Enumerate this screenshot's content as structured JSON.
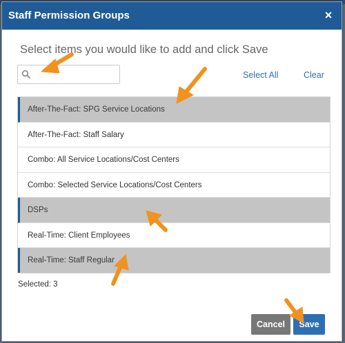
{
  "dialog": {
    "title": "Staff Permission Groups",
    "close_label": "×",
    "subtitle": "Select items you would like to add and click Save"
  },
  "search": {
    "placeholder": "",
    "value": "",
    "icon": "search-icon"
  },
  "links": {
    "select_all": "Select All",
    "clear": "Clear"
  },
  "list": {
    "items": [
      {
        "label": "After-The-Fact: SPG Service Locations",
        "selected": true
      },
      {
        "label": "After-The-Fact: Staff Salary",
        "selected": false
      },
      {
        "label": "Combo: All Service Locations/Cost Centers",
        "selected": false
      },
      {
        "label": "Combo: Selected Service Locations/Cost Centers",
        "selected": false
      },
      {
        "label": "DSPs",
        "selected": true
      },
      {
        "label": "Real-Time: Client Employees",
        "selected": false
      },
      {
        "label": "Real-Time: Staff Regular",
        "selected": true
      }
    ]
  },
  "status": {
    "selected_text": "Selected: 3"
  },
  "buttons": {
    "cancel": "Cancel",
    "save": "Save"
  },
  "colors": {
    "header_bg": "#1f5b96",
    "selected_row_bg": "#c4c4c4",
    "link": "#2d6fb3",
    "save_bg": "#2d6fb3",
    "cancel_bg": "#777777",
    "annotation_arrow": "#f0921e"
  }
}
